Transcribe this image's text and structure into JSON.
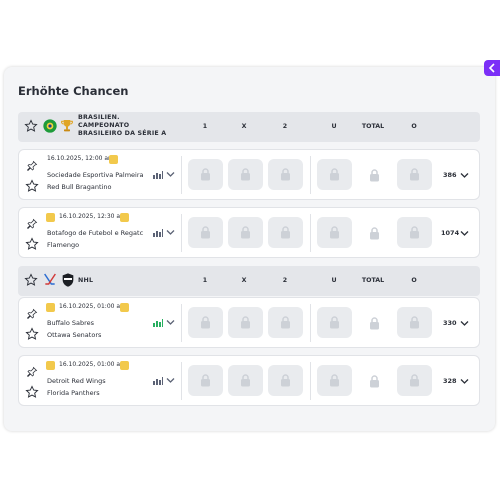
{
  "panel": {
    "title": "Erhöhte Chancen",
    "collapse_icon": "chevron-left-icon"
  },
  "colors": {
    "accent": "#7b2ff7",
    "badge": "#f2c94c",
    "stats_live": "#27ae60",
    "stats": "#5b6275"
  },
  "columns": [
    "1",
    "X",
    "2",
    "U",
    "TOTAL",
    "O"
  ],
  "leagues": [
    {
      "name_lines": [
        "BRASILIEN.",
        "CAMPEONATO",
        "BRASILEIRO DA SÉRIE A"
      ],
      "icons": [
        "star-icon",
        "soccer-ball-icon",
        "trophy-icon"
      ],
      "matches": [
        {
          "date": "16.10.2025, 12:00 am",
          "home": "Sociedade Esportiva Palmeira",
          "away": "Red Bull Bragantino",
          "count": "386",
          "stats_live": false,
          "has_live_badge": false
        },
        {
          "date": "16.10.2025, 12:30 am",
          "home": "Botafogo de Futebol e Regatc",
          "away": "Flamengo",
          "count": "1074",
          "stats_live": false,
          "has_live_badge": true
        }
      ]
    },
    {
      "name_lines": [
        "NHL"
      ],
      "icons": [
        "star-icon",
        "hockey-sticks-icon",
        "nhl-logo-icon"
      ],
      "matches": [
        {
          "date": "16.10.2025, 01:00 am",
          "home": "Buffalo Sabres",
          "away": "Ottawa Senators",
          "count": "330",
          "stats_live": true,
          "has_live_badge": true
        },
        {
          "date": "16.10.2025, 01:00 am",
          "home": "Detroit Red Wings",
          "away": "Florida Panthers",
          "count": "328",
          "stats_live": false,
          "has_live_badge": true
        }
      ]
    }
  ]
}
